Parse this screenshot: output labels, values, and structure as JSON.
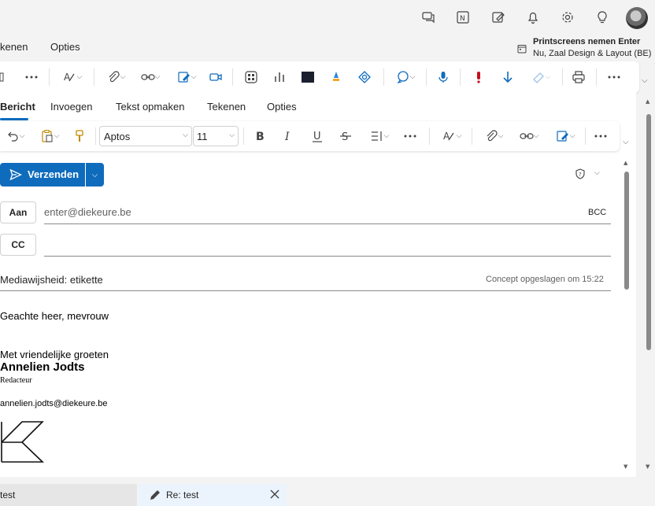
{
  "outer_tabs": [
    "kenen",
    "Opties"
  ],
  "notification": {
    "title": "Printscreens nemen Enter",
    "subtitle": "Nu, Zaal Design & Layout (BE)"
  },
  "compose": {
    "tabs": [
      "Bericht",
      "Invoegen",
      "Tekst opmaken",
      "Tekenen",
      "Opties"
    ],
    "active_tab": "Bericht",
    "font_name": "Aptos",
    "font_size": "11",
    "send_label": "Verzenden",
    "to_label": "Aan",
    "to_value": "enter@diekeure.be",
    "cc_label": "CC",
    "bcc_label": "BCC",
    "subject": "Mediawijsheid: etikette",
    "draft_status": "Concept opgeslagen om 15:22",
    "greeting": "Geachte heer, mevrouw",
    "closing": "Met vriendelijke groeten",
    "signature_name": "Annelien Jodts",
    "signature_role": "Redacteur",
    "signature_email": "annelien.jodts@diekeure.be"
  },
  "bottom_tabs": {
    "tab1": "test",
    "tab2": "Re: test"
  },
  "colors": {
    "accent": "#0f6cbd",
    "important": "#c50f1f"
  }
}
